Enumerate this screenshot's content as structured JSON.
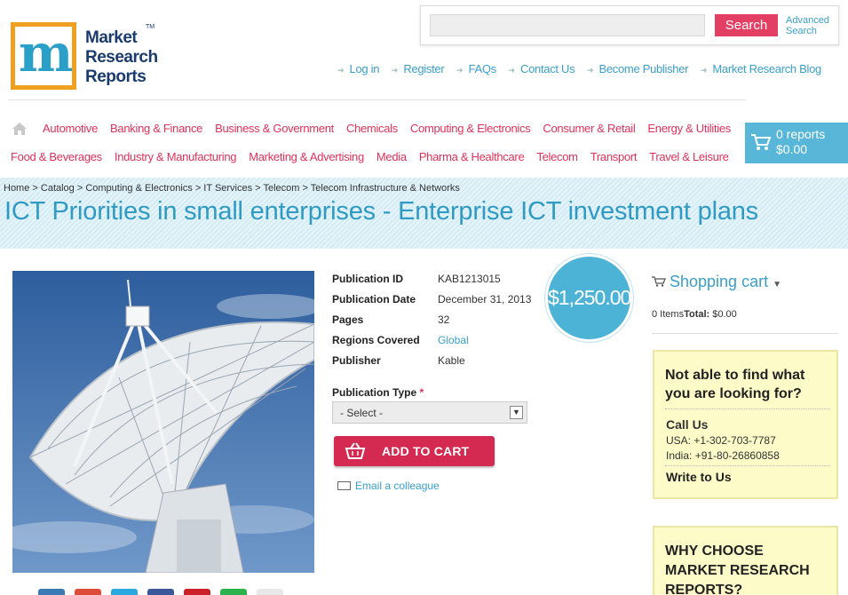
{
  "brand": {
    "name_lines": [
      "Market",
      "Research",
      "Reports"
    ],
    "tm": "TM",
    "colors": {
      "accent": "#e0315a",
      "link": "#3a9fc8",
      "band": "#d3ebf3",
      "price": "#4db3d6"
    }
  },
  "search": {
    "placeholder": "",
    "button_label": "Search",
    "advanced_label_1": "Advanced",
    "advanced_label_2": "Search"
  },
  "top_links": [
    "Log in",
    "Register",
    "FAQs",
    "Contact Us",
    "Become Publisher",
    "Market Research Blog"
  ],
  "categories_row1": [
    "Automotive",
    "Banking & Finance",
    "Business & Government",
    "Chemicals",
    "Computing & Electronics",
    "Consumer & Retail",
    "Energy & Utilities"
  ],
  "categories_row2": [
    "Food & Beverages",
    "Industry & Manufacturing",
    "Marketing & Advertising",
    "Media",
    "Pharma & Healthcare",
    "Telecom",
    "Transport",
    "Travel & Leisure"
  ],
  "cart": {
    "reports": "0 reports",
    "total": "$0.00"
  },
  "breadcrumb": "Home > Catalog > Computing & Electronics > IT Services > Telecom > Telecom Infrastructure & Networks",
  "title": "ICT Priorities in small enterprises - Enterprise ICT investment plans",
  "details": {
    "publication_id_label": "Publication ID",
    "publication_id": "KAB1213015",
    "publication_date_label": "Publication Date",
    "publication_date": "December 31, 2013",
    "pages_label": "Pages",
    "pages": "32",
    "regions_label": "Regions Covered",
    "regions": "Global",
    "publisher_label": "Publisher",
    "publisher": "Kable"
  },
  "price": "$1,250.00",
  "publication_type": {
    "label": "Publication Type",
    "required_mark": "*",
    "selected": "- Select -"
  },
  "add_to_cart_label": "ADD TO CART",
  "email_label": "Email a colleague",
  "shopping_cart": {
    "heading": "Shopping cart",
    "items": "0 Items",
    "total_label": "Total:",
    "total": "$0.00"
  },
  "help": {
    "title_line1": "Not able to find what",
    "title_line2": "you are looking for?",
    "call_us": "Call Us",
    "usa_phone": "USA: +1-302-703-7787",
    "india_phone": "India: +91-80-26860858",
    "write_us": "Write to Us"
  },
  "why": {
    "line1": "WHY CHOOSE",
    "line2": "MARKET RESEARCH",
    "line3": "REPORTS?"
  },
  "social_icons": [
    "share-icon",
    "google-plus-icon",
    "twitter-icon",
    "facebook-icon",
    "pinterest-icon",
    "email-share-icon"
  ]
}
